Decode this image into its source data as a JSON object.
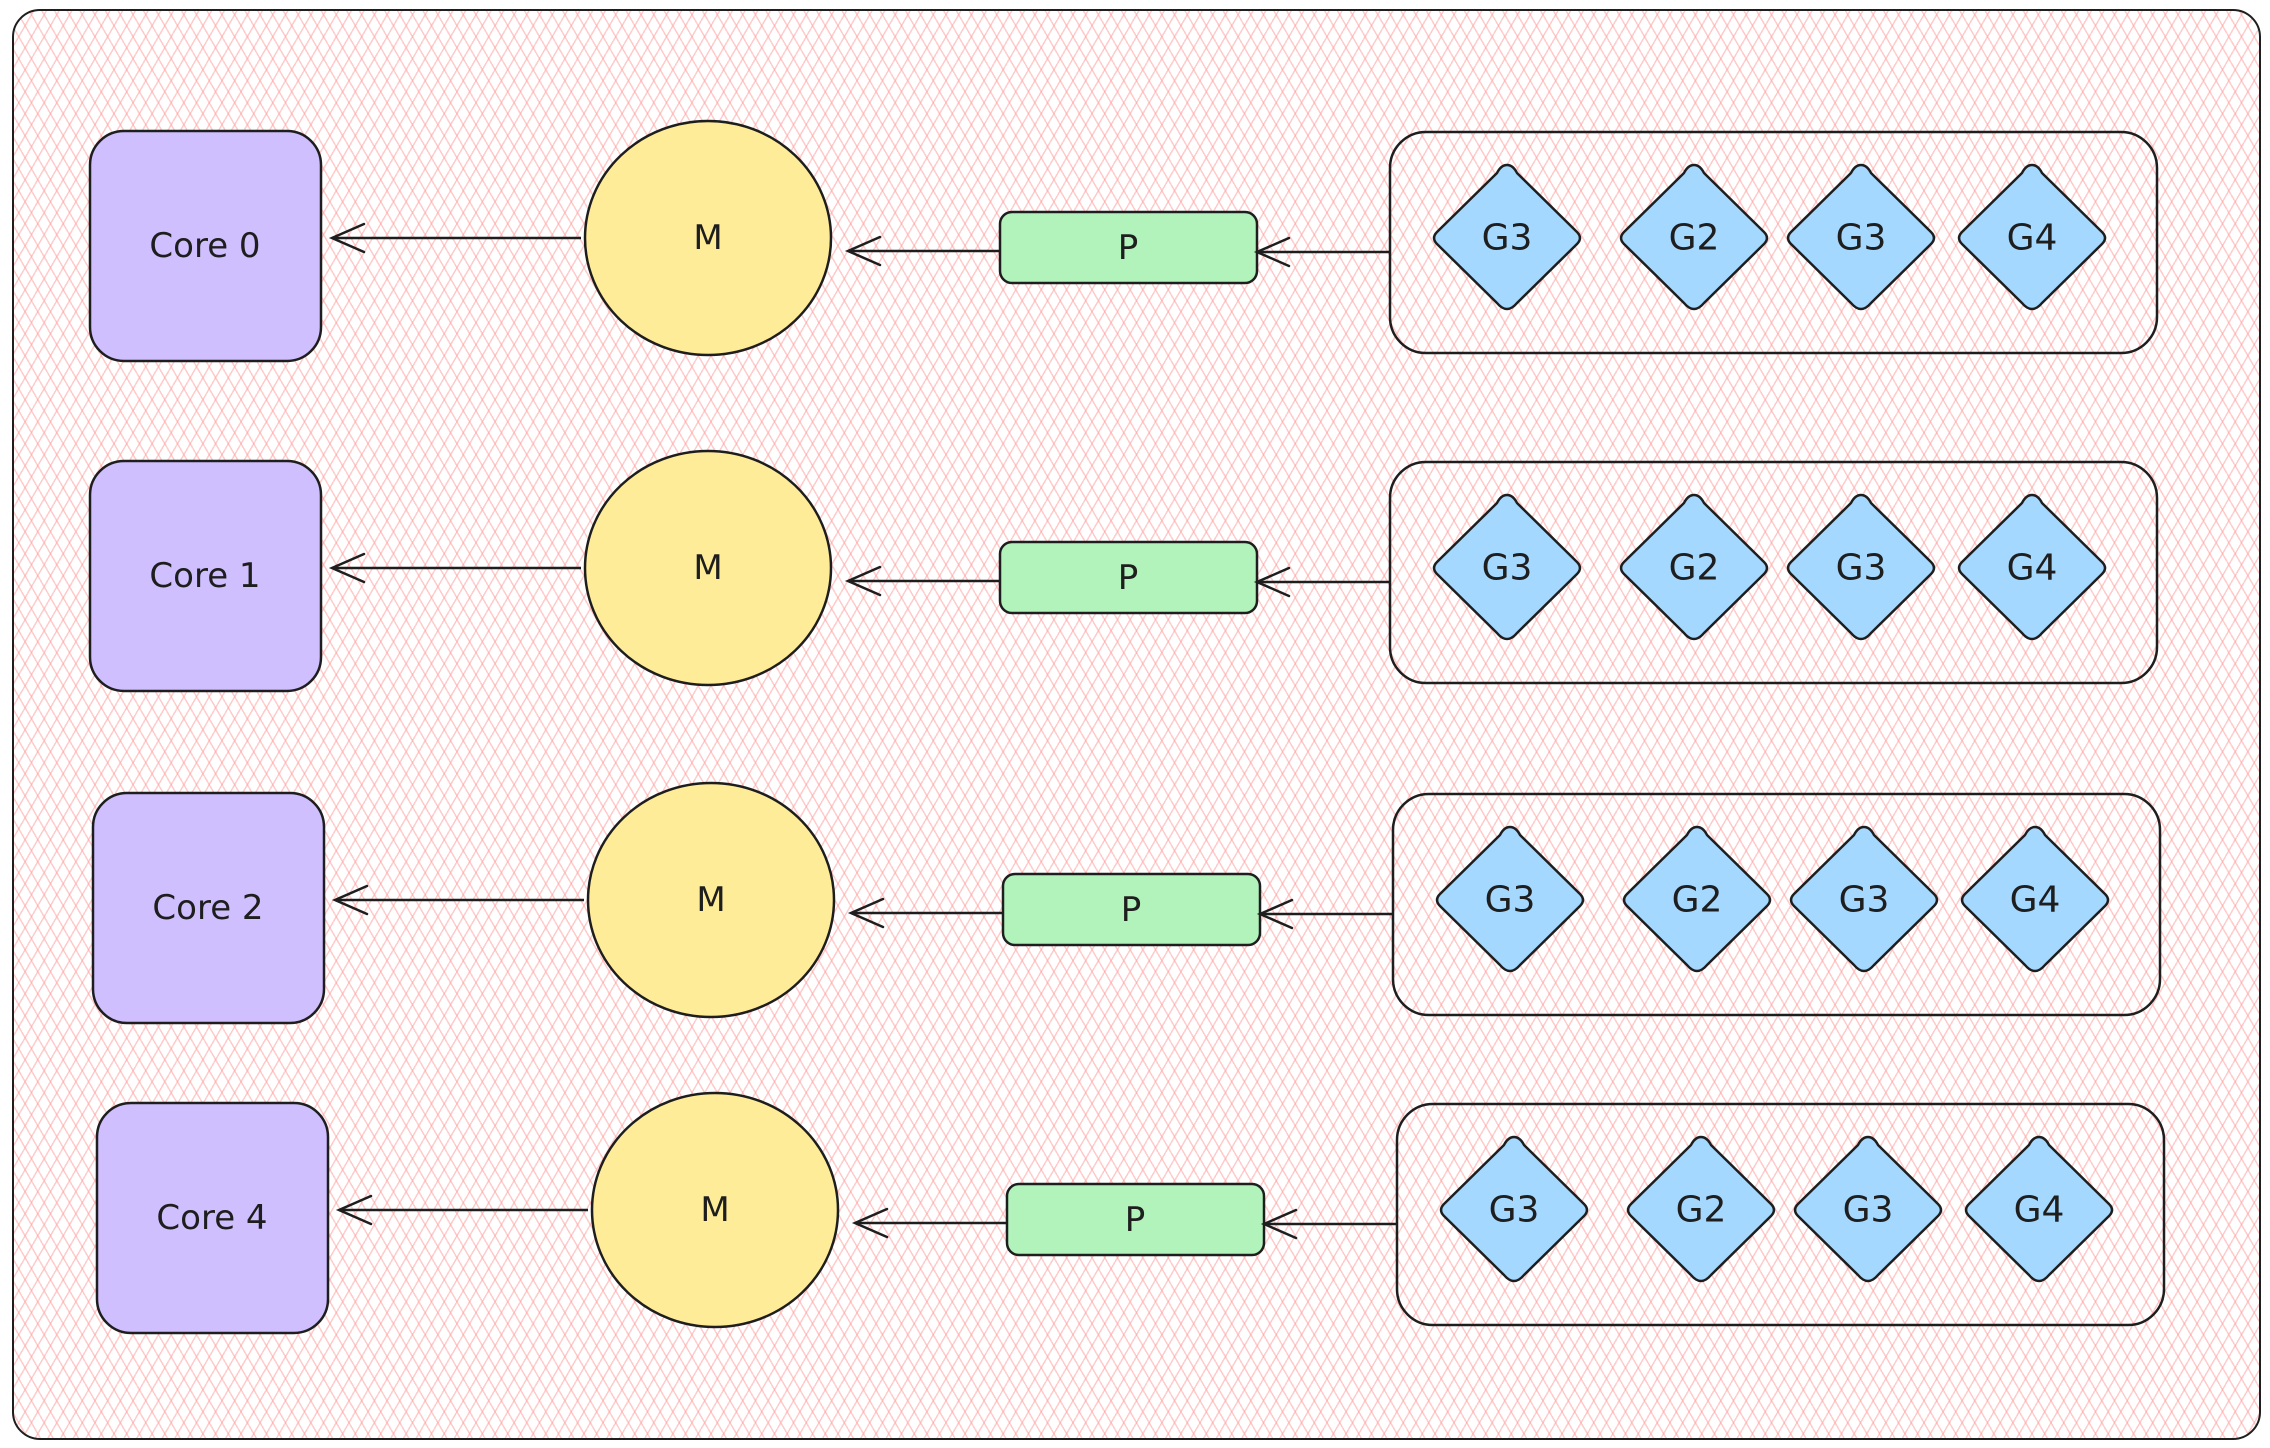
{
  "colors": {
    "core": "#d0bfff",
    "m": "#ffec99",
    "p": "#b2f2bb",
    "g": "#a5d8ff",
    "stroke": "#1e1e1e",
    "hatch": "#ffc9c9"
  },
  "rows": [
    {
      "core": "Core 0",
      "m": "M",
      "p": "P",
      "g": [
        "G3",
        "G2",
        "G3",
        "G4"
      ]
    },
    {
      "core": "Core 1",
      "m": "M",
      "p": "P",
      "g": [
        "G3",
        "G2",
        "G3",
        "G4"
      ]
    },
    {
      "core": "Core 2",
      "m": "M",
      "p": "P",
      "g": [
        "G3",
        "G2",
        "G3",
        "G4"
      ]
    },
    {
      "core": "Core 4",
      "m": "M",
      "p": "P",
      "g": [
        "G3",
        "G2",
        "G3",
        "G4"
      ]
    }
  ]
}
